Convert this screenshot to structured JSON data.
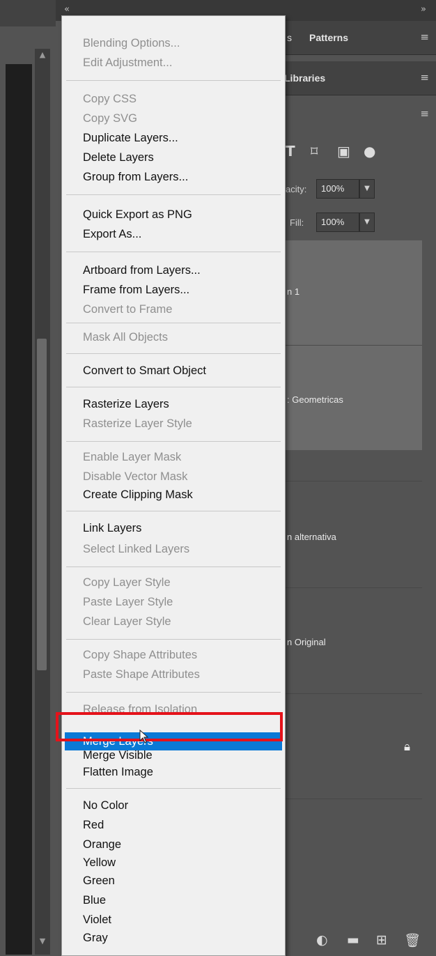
{
  "panels": {
    "tabs_row1": {
      "tab_patterns": "Patterns",
      "menu_icon": "≡"
    },
    "tabs_row2": {
      "tab_libraries": "Libraries",
      "menu_icon": "≡"
    },
    "row3": {
      "menu_icon": "≡"
    },
    "collapse_left": "«",
    "collapse_right": "»"
  },
  "layers_panel": {
    "opacity_label": "acity:",
    "opacity_value": "100%",
    "fill_label": "Fill:",
    "fill_value": "100%",
    "layers": [
      {
        "label": "n 1",
        "selected": true
      },
      {
        "label": ": Geometricas",
        "selected": true
      },
      {
        "label": "n alternativa",
        "selected": false
      },
      {
        "label": "n Original",
        "selected": false
      },
      {
        "label": "",
        "selected": false,
        "locked": true
      }
    ]
  },
  "context_menu": {
    "items": [
      {
        "label": "Blending Options...",
        "enabled": false
      },
      {
        "label": "Edit Adjustment...",
        "enabled": false
      },
      {
        "label": "Copy CSS",
        "enabled": false
      },
      {
        "label": "Copy SVG",
        "enabled": false
      },
      {
        "label": "Duplicate Layers...",
        "enabled": true
      },
      {
        "label": "Delete Layers",
        "enabled": true
      },
      {
        "label": "Group from Layers...",
        "enabled": true
      },
      {
        "label": "Quick Export as PNG",
        "enabled": true
      },
      {
        "label": "Export As...",
        "enabled": true
      },
      {
        "label": "Artboard from Layers...",
        "enabled": true
      },
      {
        "label": "Frame from Layers...",
        "enabled": true
      },
      {
        "label": "Convert to Frame",
        "enabled": false
      },
      {
        "label": "Mask All Objects",
        "enabled": false
      },
      {
        "label": "Convert to Smart Object",
        "enabled": true
      },
      {
        "label": "Rasterize Layers",
        "enabled": true
      },
      {
        "label": "Rasterize Layer Style",
        "enabled": false
      },
      {
        "label": "Enable Layer Mask",
        "enabled": false
      },
      {
        "label": "Disable Vector Mask",
        "enabled": false
      },
      {
        "label": "Create Clipping Mask",
        "enabled": true
      },
      {
        "label": "Link Layers",
        "enabled": true
      },
      {
        "label": "Select Linked Layers",
        "enabled": false
      },
      {
        "label": "Copy Layer Style",
        "enabled": false
      },
      {
        "label": "Paste Layer Style",
        "enabled": false
      },
      {
        "label": "Clear Layer Style",
        "enabled": false
      },
      {
        "label": "Copy Shape Attributes",
        "enabled": false
      },
      {
        "label": "Paste Shape Attributes",
        "enabled": false
      },
      {
        "label": "Release from Isolation",
        "enabled": false
      },
      {
        "label": "Merge Layers",
        "enabled": true,
        "highlighted": true
      },
      {
        "label": "Merge Visible",
        "enabled": true
      },
      {
        "label": "Flatten Image",
        "enabled": true
      },
      {
        "label": "No Color",
        "enabled": true
      },
      {
        "label": "Red",
        "enabled": true
      },
      {
        "label": "Orange",
        "enabled": true
      },
      {
        "label": "Yellow",
        "enabled": true
      },
      {
        "label": "Green",
        "enabled": true
      },
      {
        "label": "Blue",
        "enabled": true
      },
      {
        "label": "Violet",
        "enabled": true
      },
      {
        "label": "Gray",
        "enabled": true
      }
    ]
  },
  "colors": {
    "menu_bg": "#f0f0f0",
    "highlight": "#0a79d6",
    "annotation_box": "#e5121a",
    "panel_bg": "#535353",
    "selected_layer_bg": "#6b6b6b"
  },
  "icons": {
    "toolbar": [
      "type-filter-icon",
      "shape-filter-icon",
      "smart-object-filter-icon",
      "toggle-filter-icon"
    ],
    "bottom": [
      "adjustment-layer-icon",
      "new-group-icon",
      "new-layer-icon",
      "trash-icon"
    ]
  }
}
